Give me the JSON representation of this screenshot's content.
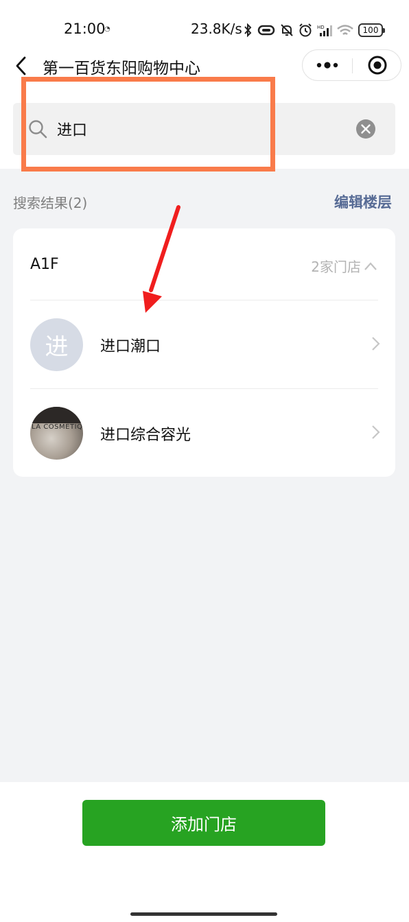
{
  "status_bar": {
    "time": "21:00",
    "network_speed": "23.8K/s",
    "battery": "100",
    "icons": [
      "bluetooth-icon",
      "vibrate-icon",
      "mute-icon",
      "alarm-icon",
      "signal-icon",
      "wifi-icon",
      "battery-icon"
    ]
  },
  "nav": {
    "title": "第一百货东阳购物中心",
    "back_icon": "chevron-left-icon",
    "more_icon": "more-dots-icon",
    "close_icon": "target-icon"
  },
  "search": {
    "value": "进口",
    "placeholder": "",
    "search_icon": "search-icon",
    "clear_icon": "clear-icon"
  },
  "results": {
    "label": "搜索结果(2)",
    "edit_floor": "编辑楼层"
  },
  "floor_group": {
    "floor": "A1F",
    "count": "2家门店",
    "stores": [
      {
        "name": "进口潮口",
        "avatar_text": "进"
      },
      {
        "name": "进口综合容光",
        "avatar_photo_text": "LA COSMETIQU"
      }
    ]
  },
  "bottom": {
    "add_button": "添加门店"
  },
  "colors": {
    "accent_green": "#27a322",
    "link_blue": "#576b95",
    "highlight_orange": "#f97b4a",
    "annotation_red": "#f01e1e"
  }
}
